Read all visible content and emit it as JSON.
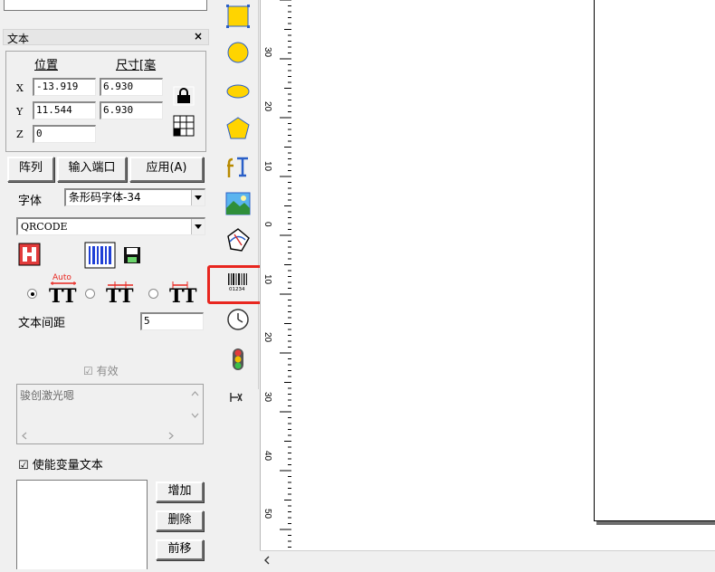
{
  "panel": {
    "title": "文本",
    "close_label": "×",
    "position_label": "位置",
    "size_label": "尺寸[毫",
    "x_label": "X",
    "y_label": "Y",
    "z_label": "Z",
    "x_value": "-13.919",
    "y_value": "11.544",
    "z_value": "0",
    "width_value": "6.930",
    "height_value": "6.930",
    "array_button": "阵列",
    "input_port_button": "输入端口",
    "apply_button": "应用(A)",
    "font_label": "字体",
    "font_value": "条形码字体-34",
    "barcode_type_value": "QRCODE",
    "auto_label": "Auto",
    "text_spacing_label": "文本间距",
    "text_spacing_value": "5",
    "valid_label": "有效",
    "valid_checked": "☑",
    "text_content": "骏创激光嗯",
    "enable_variable_label": "使能变量文本",
    "enable_variable_check": "☑",
    "add_button": "增加",
    "delete_button": "删除",
    "move_up_button": "前移"
  },
  "ruler": {
    "labels": [
      "30",
      "20",
      "10",
      "0",
      "10",
      "20",
      "30",
      "40",
      "50"
    ]
  },
  "colors": {
    "highlight": "#e8261f",
    "shape_yellow": "#ffd400",
    "shape_blue": "#2a5fc8"
  },
  "icons": {
    "toolbar": [
      "rectangle-icon",
      "circle-icon",
      "ellipse-icon",
      "polygon-icon",
      "text-icon",
      "bitmap-icon",
      "vector-file-icon",
      "barcode-icon",
      "timer-icon",
      "input-port-icon",
      "delay-icon"
    ]
  }
}
